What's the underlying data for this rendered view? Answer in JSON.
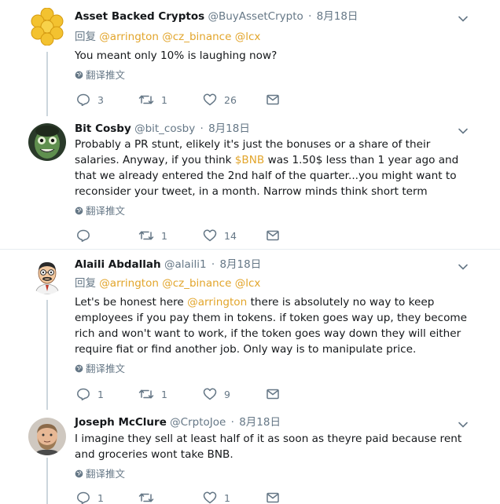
{
  "translate_label": "翻译推文",
  "tweets": [
    {
      "name": "Asset Backed Cryptos",
      "handle": "@BuyAssetCrypto",
      "date": "8月18日",
      "replying_prefix": "回复",
      "replying_mentions": [
        "@arrington",
        "@cz_binance",
        "@lcx"
      ],
      "text": "You meant only 10% is laughing now?",
      "reply_count": "3",
      "retweet_count": "1",
      "like_count": "26",
      "avatar_icon": "gold-coins-avatar"
    },
    {
      "name": "Bit Cosby",
      "handle": "@bit_cosby",
      "date": "8月18日",
      "text_parts": [
        "Probably a PR stunt, elikely it's just the bonuses or a share of their salaries. Anyway, if you think ",
        "$BNB",
        " was 1.50$ less than 1 year ago and that we already entered the 2nd half of the quarter...you might want to reconsider your tweet, in a month. Narrow minds think short term"
      ],
      "reply_count": "",
      "retweet_count": "1",
      "like_count": "14",
      "avatar_icon": "green-face-avatar"
    },
    {
      "name": "Alaili Abdallah",
      "handle": "@alaili1",
      "date": "8月18日",
      "replying_prefix": "回复",
      "replying_mentions": [
        "@arrington",
        "@cz_binance",
        "@lcx"
      ],
      "text_parts": [
        "Let's be honest here ",
        "@arrington",
        " there is absolutely no way to keep employees if you pay them in tokens. if token goes way up, they become rich and won't want to work, if the token goes way down they will either require fiat or find another job. Only way is to manipulate price."
      ],
      "reply_count": "1",
      "retweet_count": "1",
      "like_count": "9",
      "avatar_icon": "cartoon-man-avatar"
    },
    {
      "name": "Joseph McClure",
      "handle": "@CrptoJoe",
      "date": "8月18日",
      "text": "I imagine they sell at least  half of it as soon as theyre paid because rent and groceries wont take BNB.",
      "reply_count": "1",
      "retweet_count": "",
      "like_count": "1",
      "avatar_icon": "bearded-man-avatar"
    }
  ],
  "colors": {
    "link": "#e2a52b",
    "muted": "#657786",
    "text": "#14171a",
    "thread_line": "#ccd6dd",
    "separator": "#e6ecf0"
  }
}
